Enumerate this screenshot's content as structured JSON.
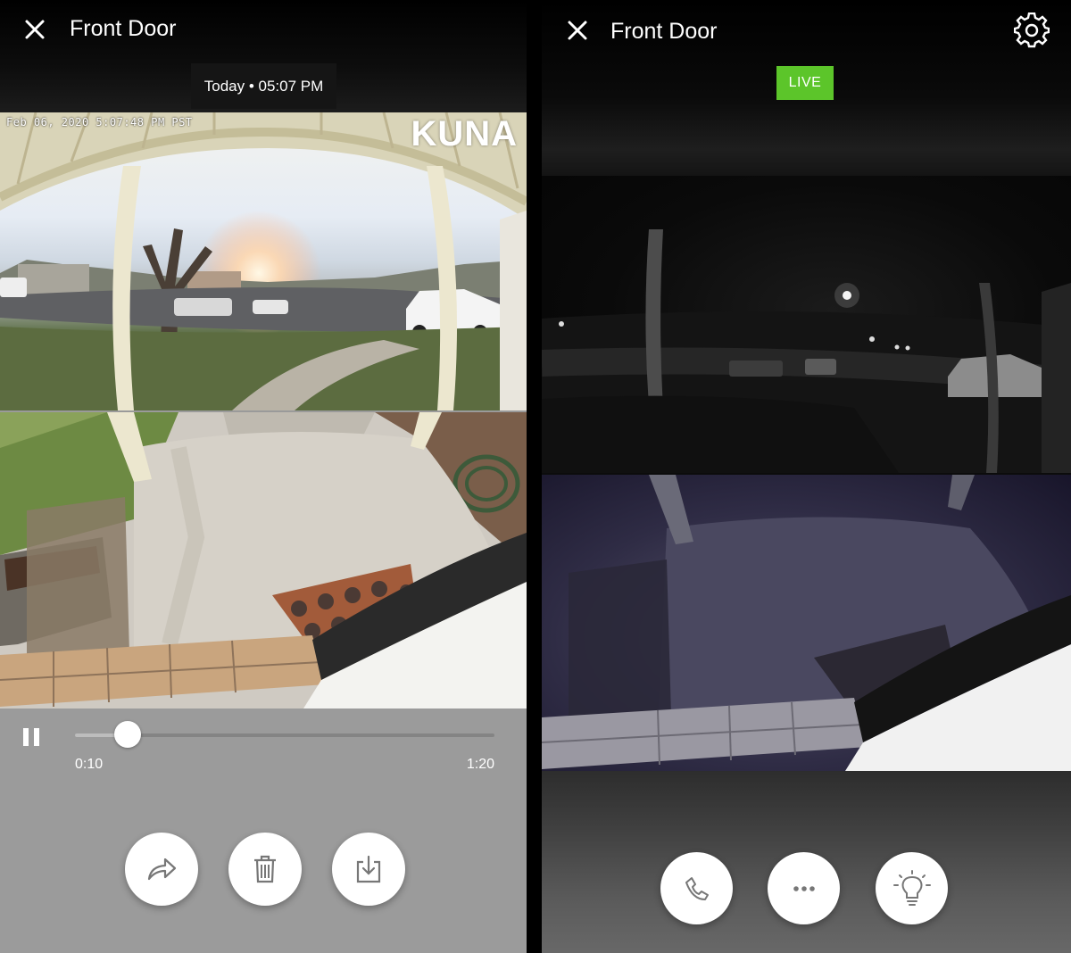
{
  "left": {
    "title": "Front Door",
    "timestamp_chip": "Today • 05:07 PM",
    "video": {
      "overlay_timestamp": "Feb 06, 2020  5:07:48 PM PST",
      "brand": "KUNA"
    },
    "playback": {
      "current_time": "0:10",
      "total_time": "1:20",
      "progress_fraction": 0.125
    },
    "actions": [
      {
        "icon": "share-icon"
      },
      {
        "icon": "trash-icon"
      },
      {
        "icon": "download-icon"
      }
    ]
  },
  "right": {
    "title": "Front Door",
    "live_badge": "LIVE",
    "actions": [
      {
        "icon": "phone-icon"
      },
      {
        "icon": "more-icon"
      },
      {
        "icon": "lightbulb-icon"
      }
    ]
  },
  "colors": {
    "live_green": "#5cc52a",
    "left_control_bg": "#9b9b9b",
    "icon_gray": "#777777"
  }
}
